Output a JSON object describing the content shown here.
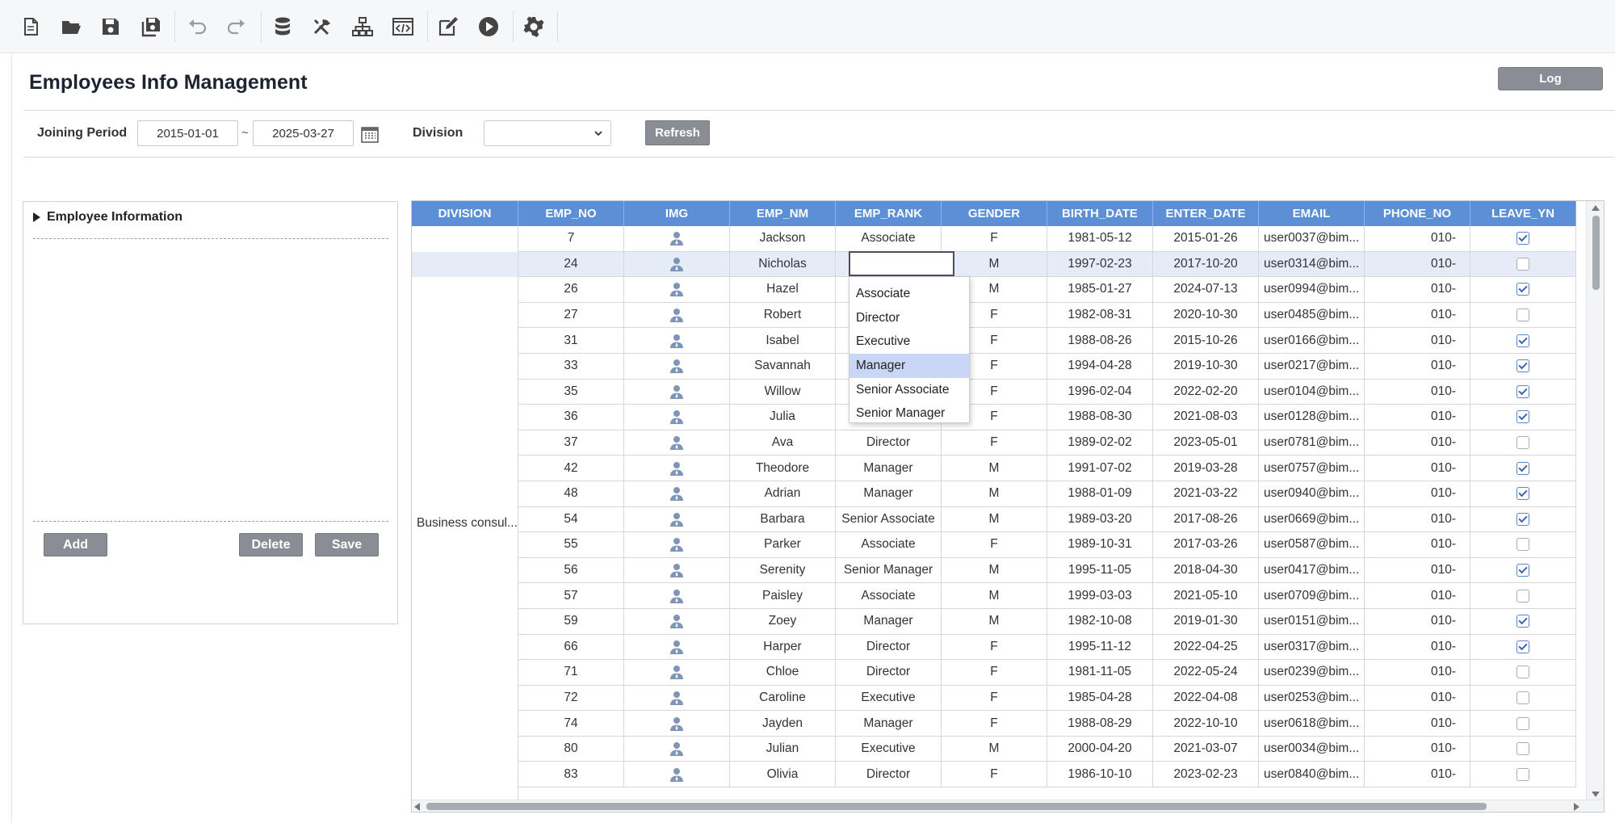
{
  "toolbar": {
    "buttons": [
      "new-file-icon",
      "open-folder-icon",
      "save-icon",
      "save-all-icon",
      "undo-icon",
      "redo-icon",
      "database-icon",
      "tools-icon",
      "hierarchy-icon",
      "code-view-icon",
      "edit-icon",
      "run-icon",
      "settings-icon"
    ]
  },
  "page": {
    "title": "Employees Info Management",
    "log_label": "Log"
  },
  "filters": {
    "joining_period_label": "Joining Period",
    "date_from": "2015-01-01",
    "separator": "~",
    "date_to": "2025-03-27",
    "division_label": "Division",
    "division_value": "",
    "refresh_label": "Refresh"
  },
  "tree": {
    "header": "Employee Information",
    "add_label": "Add",
    "delete_label": "Delete",
    "save_label": "Save"
  },
  "grid": {
    "columns": [
      "DIVISION",
      "EMP_NO",
      "IMG",
      "EMP_NM",
      "EMP_RANK",
      "GENDER",
      "BIRTH_DATE",
      "ENTER_DATE",
      "EMAIL",
      "PHONE_NO",
      "LEAVE_YN"
    ],
    "division_value": "Business consul...",
    "selected_row": 1,
    "rows": [
      {
        "emp_no": "7",
        "emp_nm": "Jackson",
        "emp_rank": "Associate",
        "gender": "F",
        "birth_date": "1981-05-12",
        "enter_date": "2015-01-26",
        "email": "user0037@bim...",
        "phone_no": "010-",
        "leave_yn": true
      },
      {
        "emp_no": "24",
        "emp_nm": "Nicholas",
        "emp_rank": "",
        "gender": "M",
        "birth_date": "1997-02-23",
        "enter_date": "2017-10-20",
        "email": "user0314@bim...",
        "phone_no": "010-",
        "leave_yn": false
      },
      {
        "emp_no": "26",
        "emp_nm": "Hazel",
        "emp_rank": "",
        "gender": "M",
        "birth_date": "1985-01-27",
        "enter_date": "2024-07-13",
        "email": "user0994@bim...",
        "phone_no": "010-",
        "leave_yn": true
      },
      {
        "emp_no": "27",
        "emp_nm": "Robert",
        "emp_rank": "",
        "gender": "F",
        "birth_date": "1982-08-31",
        "enter_date": "2020-10-30",
        "email": "user0485@bim...",
        "phone_no": "010-",
        "leave_yn": false
      },
      {
        "emp_no": "31",
        "emp_nm": "Isabel",
        "emp_rank": "",
        "gender": "F",
        "birth_date": "1988-08-26",
        "enter_date": "2015-10-26",
        "email": "user0166@bim...",
        "phone_no": "010-",
        "leave_yn": true
      },
      {
        "emp_no": "33",
        "emp_nm": "Savannah",
        "emp_rank": "",
        "gender": "F",
        "birth_date": "1994-04-28",
        "enter_date": "2019-10-30",
        "email": "user0217@bim...",
        "phone_no": "010-",
        "leave_yn": true
      },
      {
        "emp_no": "35",
        "emp_nm": "Willow",
        "emp_rank": "",
        "gender": "F",
        "birth_date": "1996-02-04",
        "enter_date": "2022-02-20",
        "email": "user0104@bim...",
        "phone_no": "010-",
        "leave_yn": true
      },
      {
        "emp_no": "36",
        "emp_nm": "Julia",
        "emp_rank": "",
        "gender": "F",
        "birth_date": "1988-08-30",
        "enter_date": "2021-08-03",
        "email": "user0128@bim...",
        "phone_no": "010-",
        "leave_yn": true
      },
      {
        "emp_no": "37",
        "emp_nm": "Ava",
        "emp_rank": "Director",
        "gender": "F",
        "birth_date": "1989-02-02",
        "enter_date": "2023-05-01",
        "email": "user0781@bim...",
        "phone_no": "010-",
        "leave_yn": false
      },
      {
        "emp_no": "42",
        "emp_nm": "Theodore",
        "emp_rank": "Manager",
        "gender": "M",
        "birth_date": "1991-07-02",
        "enter_date": "2019-03-28",
        "email": "user0757@bim...",
        "phone_no": "010-",
        "leave_yn": true
      },
      {
        "emp_no": "48",
        "emp_nm": "Adrian",
        "emp_rank": "Manager",
        "gender": "M",
        "birth_date": "1988-01-09",
        "enter_date": "2021-03-22",
        "email": "user0940@bim...",
        "phone_no": "010-",
        "leave_yn": true
      },
      {
        "emp_no": "54",
        "emp_nm": "Barbara",
        "emp_rank": "Senior Associate",
        "gender": "M",
        "birth_date": "1989-03-20",
        "enter_date": "2017-08-26",
        "email": "user0669@bim...",
        "phone_no": "010-",
        "leave_yn": true
      },
      {
        "emp_no": "55",
        "emp_nm": "Parker",
        "emp_rank": "Associate",
        "gender": "F",
        "birth_date": "1989-10-31",
        "enter_date": "2017-03-26",
        "email": "user0587@bim...",
        "phone_no": "010-",
        "leave_yn": false
      },
      {
        "emp_no": "56",
        "emp_nm": "Serenity",
        "emp_rank": "Senior Manager",
        "gender": "M",
        "birth_date": "1995-11-05",
        "enter_date": "2018-04-30",
        "email": "user0417@bim...",
        "phone_no": "010-",
        "leave_yn": true
      },
      {
        "emp_no": "57",
        "emp_nm": "Paisley",
        "emp_rank": "Associate",
        "gender": "M",
        "birth_date": "1999-03-03",
        "enter_date": "2021-05-10",
        "email": "user0709@bim...",
        "phone_no": "010-",
        "leave_yn": false
      },
      {
        "emp_no": "59",
        "emp_nm": "Zoey",
        "emp_rank": "Manager",
        "gender": "M",
        "birth_date": "1982-10-08",
        "enter_date": "2019-01-30",
        "email": "user0151@bim...",
        "phone_no": "010-",
        "leave_yn": true
      },
      {
        "emp_no": "66",
        "emp_nm": "Harper",
        "emp_rank": "Director",
        "gender": "F",
        "birth_date": "1995-11-12",
        "enter_date": "2022-04-25",
        "email": "user0317@bim...",
        "phone_no": "010-",
        "leave_yn": true
      },
      {
        "emp_no": "71",
        "emp_nm": "Chloe",
        "emp_rank": "Director",
        "gender": "F",
        "birth_date": "1981-11-05",
        "enter_date": "2022-05-24",
        "email": "user0239@bim...",
        "phone_no": "010-",
        "leave_yn": false
      },
      {
        "emp_no": "72",
        "emp_nm": "Caroline",
        "emp_rank": "Executive",
        "gender": "F",
        "birth_date": "1985-04-28",
        "enter_date": "2022-04-08",
        "email": "user0253@bim...",
        "phone_no": "010-",
        "leave_yn": false
      },
      {
        "emp_no": "74",
        "emp_nm": "Jayden",
        "emp_rank": "Manager",
        "gender": "F",
        "birth_date": "1988-08-29",
        "enter_date": "2022-10-10",
        "email": "user0618@bim...",
        "phone_no": "010-",
        "leave_yn": false
      },
      {
        "emp_no": "80",
        "emp_nm": "Julian",
        "emp_rank": "Executive",
        "gender": "M",
        "birth_date": "2000-04-20",
        "enter_date": "2021-03-07",
        "email": "user0034@bim...",
        "phone_no": "010-",
        "leave_yn": false
      },
      {
        "emp_no": "83",
        "emp_nm": "Olivia",
        "emp_rank": "Director",
        "gender": "F",
        "birth_date": "1986-10-10",
        "enter_date": "2023-02-23",
        "email": "user0840@bim...",
        "phone_no": "010-",
        "leave_yn": false
      }
    ]
  },
  "rank_dropdown": {
    "options": [
      "Associate",
      "Director",
      "Executive",
      "Manager",
      "Senior Associate",
      "Senior Manager"
    ],
    "highlighted": "Manager"
  },
  "colors": {
    "header_bg": "#5b8fd6",
    "button_gray": "#8a8d93",
    "selected_row": "#e6ebf8",
    "dropdown_highlight": "#c9d6f5"
  }
}
